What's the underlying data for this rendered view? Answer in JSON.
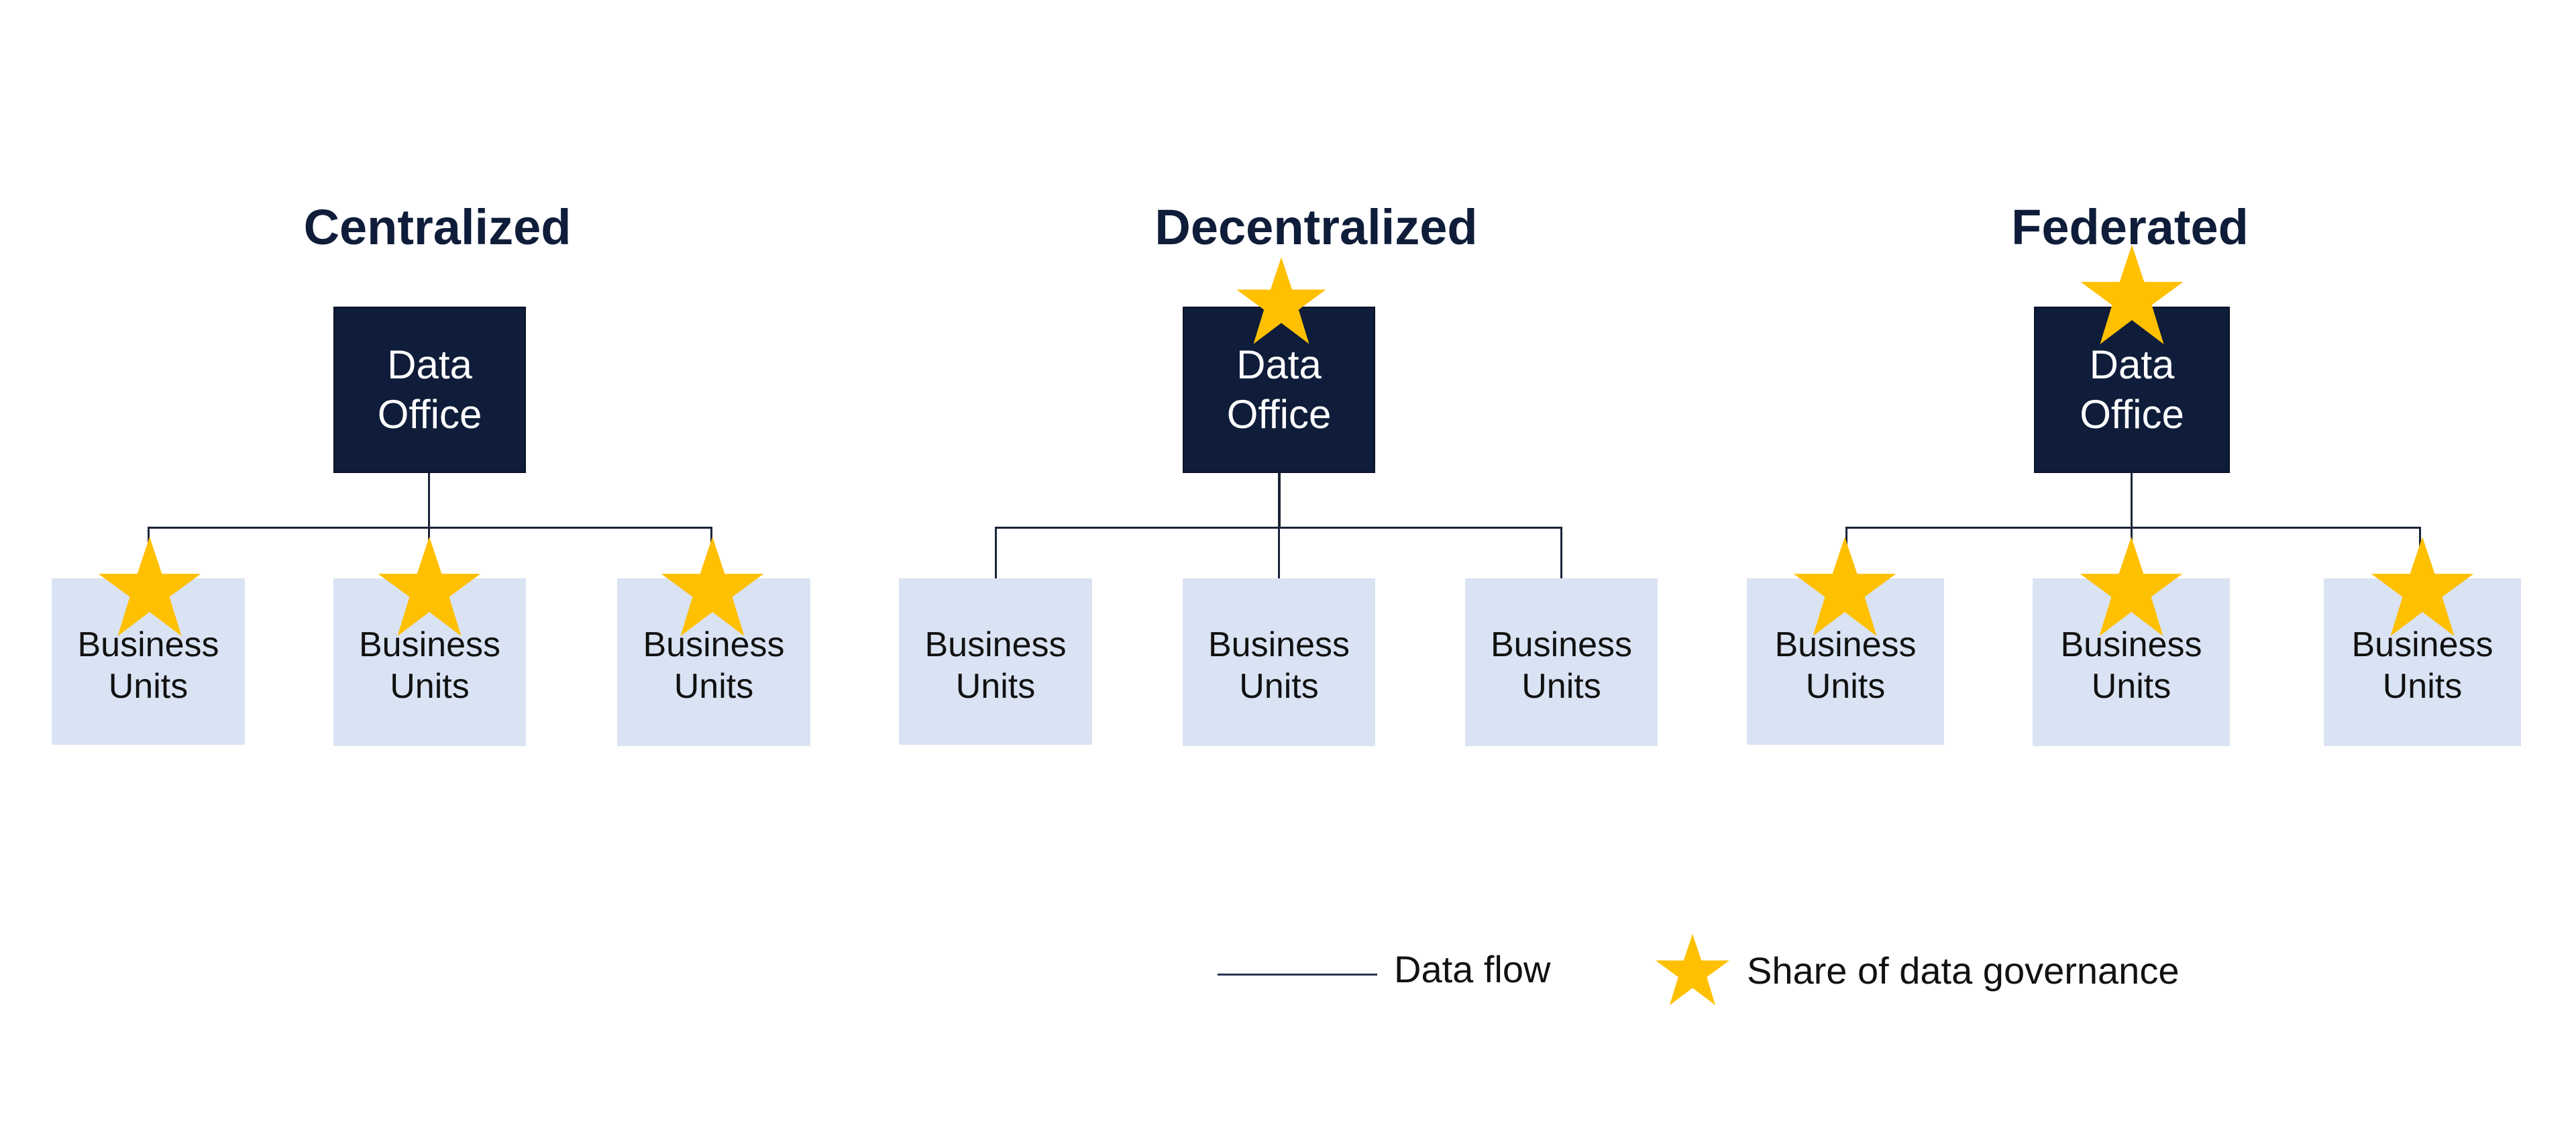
{
  "diagram": {
    "models": [
      {
        "title": "Centralized",
        "office": {
          "line1": "Data",
          "line2": "Office",
          "has_star": false
        },
        "units": [
          {
            "line1": "Business",
            "line2": "Units",
            "has_star": true
          },
          {
            "line1": "Business",
            "line2": "Units",
            "has_star": true
          },
          {
            "line1": "Business",
            "line2": "Units",
            "has_star": true
          }
        ]
      },
      {
        "title": "Decentralized",
        "office": {
          "line1": "Data",
          "line2": "Office",
          "has_star": true
        },
        "units": [
          {
            "line1": "Business",
            "line2": "Units",
            "has_star": false
          },
          {
            "line1": "Business",
            "line2": "Units",
            "has_star": false
          },
          {
            "line1": "Business",
            "line2": "Units",
            "has_star": false
          }
        ]
      },
      {
        "title": "Federated",
        "office": {
          "line1": "Data",
          "line2": "Office",
          "has_star": true
        },
        "units": [
          {
            "line1": "Business",
            "line2": "Units",
            "has_star": true
          },
          {
            "line1": "Business",
            "line2": "Units",
            "has_star": true
          },
          {
            "line1": "Business",
            "line2": "Units",
            "has_star": true
          }
        ]
      }
    ],
    "legend": {
      "data_flow_label": "Data flow",
      "governance_label": "Share of data governance"
    },
    "colors": {
      "office_fill": "#0f1d3a",
      "unit_fill": "#dae3f3",
      "star_fill": "#ffc000",
      "title_text": "#0f1d3a",
      "line": "#1b2438"
    }
  }
}
